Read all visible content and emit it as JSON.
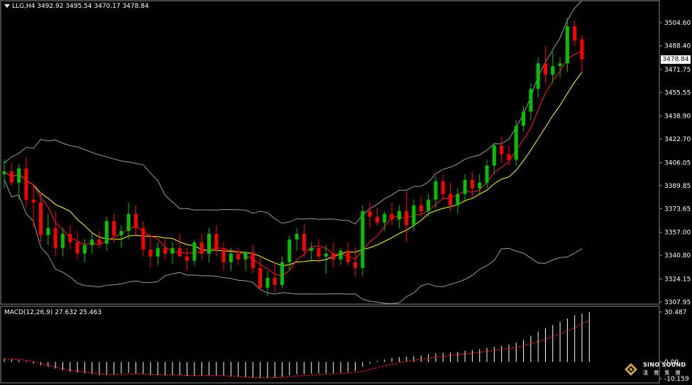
{
  "header": {
    "symbol_line": "LLG,H4  3492.92 3495.54 3470.17 3478.84"
  },
  "macd_header": "MACD(12,26,9) 27.632 25.463",
  "current_price_tag": "3478.84",
  "price_axis": [
    "3504.60",
    "3488.40",
    "3471.75",
    "3455.55",
    "3438.90",
    "3422.70",
    "3406.05",
    "3389.85",
    "3373.65",
    "3357.00",
    "3340.80",
    "3324.15",
    "3307.95"
  ],
  "macd_axis": [
    "30.487",
    "0.00",
    "-10.159"
  ],
  "logo": {
    "name": "SINO SOUND",
    "sub": "漢 聲 集 團"
  },
  "colors": {
    "bull": "#00c000",
    "bear": "#ff0000",
    "ma_fast": "#ff2020",
    "ma_slow": "#ffff40",
    "band": "#9a9a9a",
    "macd_signal": "#ff2020",
    "hist": "#ffffff"
  },
  "chart_data": {
    "type": "candlestick",
    "timeframe": "H4",
    "ylim": [
      3307.95,
      3504.6
    ],
    "candles": [
      {
        "o": 3398,
        "h": 3408,
        "l": 3388,
        "c": 3400
      },
      {
        "o": 3400,
        "h": 3406,
        "l": 3390,
        "c": 3392
      },
      {
        "o": 3392,
        "h": 3405,
        "l": 3380,
        "c": 3402
      },
      {
        "o": 3402,
        "h": 3410,
        "l": 3375,
        "c": 3380
      },
      {
        "o": 3380,
        "h": 3390,
        "l": 3360,
        "c": 3378
      },
      {
        "o": 3378,
        "h": 3385,
        "l": 3350,
        "c": 3355
      },
      {
        "o": 3355,
        "h": 3370,
        "l": 3348,
        "c": 3360
      },
      {
        "o": 3360,
        "h": 3372,
        "l": 3340,
        "c": 3346
      },
      {
        "o": 3346,
        "h": 3360,
        "l": 3340,
        "c": 3356
      },
      {
        "o": 3356,
        "h": 3362,
        "l": 3345,
        "c": 3350
      },
      {
        "o": 3350,
        "h": 3358,
        "l": 3338,
        "c": 3342
      },
      {
        "o": 3342,
        "h": 3352,
        "l": 3336,
        "c": 3348
      },
      {
        "o": 3348,
        "h": 3356,
        "l": 3342,
        "c": 3352
      },
      {
        "o": 3352,
        "h": 3358,
        "l": 3346,
        "c": 3349
      },
      {
        "o": 3349,
        "h": 3368,
        "l": 3344,
        "c": 3365
      },
      {
        "o": 3365,
        "h": 3370,
        "l": 3350,
        "c": 3355
      },
      {
        "o": 3355,
        "h": 3362,
        "l": 3346,
        "c": 3358
      },
      {
        "o": 3358,
        "h": 3378,
        "l": 3352,
        "c": 3370
      },
      {
        "o": 3370,
        "h": 3376,
        "l": 3355,
        "c": 3360
      },
      {
        "o": 3360,
        "h": 3365,
        "l": 3340,
        "c": 3345
      },
      {
        "o": 3345,
        "h": 3355,
        "l": 3332,
        "c": 3340
      },
      {
        "o": 3340,
        "h": 3350,
        "l": 3334,
        "c": 3346
      },
      {
        "o": 3346,
        "h": 3352,
        "l": 3338,
        "c": 3342
      },
      {
        "o": 3342,
        "h": 3350,
        "l": 3335,
        "c": 3346
      },
      {
        "o": 3346,
        "h": 3356,
        "l": 3340,
        "c": 3340
      },
      {
        "o": 3340,
        "h": 3346,
        "l": 3330,
        "c": 3337
      },
      {
        "o": 3337,
        "h": 3352,
        "l": 3334,
        "c": 3350
      },
      {
        "o": 3350,
        "h": 3356,
        "l": 3338,
        "c": 3342
      },
      {
        "o": 3342,
        "h": 3360,
        "l": 3336,
        "c": 3356
      },
      {
        "o": 3356,
        "h": 3362,
        "l": 3340,
        "c": 3345
      },
      {
        "o": 3345,
        "h": 3350,
        "l": 3330,
        "c": 3336
      },
      {
        "o": 3336,
        "h": 3346,
        "l": 3330,
        "c": 3342
      },
      {
        "o": 3342,
        "h": 3346,
        "l": 3334,
        "c": 3338
      },
      {
        "o": 3338,
        "h": 3344,
        "l": 3330,
        "c": 3343
      },
      {
        "o": 3343,
        "h": 3348,
        "l": 3328,
        "c": 3332
      },
      {
        "o": 3332,
        "h": 3340,
        "l": 3316,
        "c": 3318
      },
      {
        "o": 3318,
        "h": 3330,
        "l": 3312,
        "c": 3325
      },
      {
        "o": 3325,
        "h": 3336,
        "l": 3315,
        "c": 3320
      },
      {
        "o": 3320,
        "h": 3340,
        "l": 3318,
        "c": 3336
      },
      {
        "o": 3336,
        "h": 3355,
        "l": 3330,
        "c": 3352
      },
      {
        "o": 3352,
        "h": 3360,
        "l": 3344,
        "c": 3356
      },
      {
        "o": 3356,
        "h": 3362,
        "l": 3340,
        "c": 3344
      },
      {
        "o": 3344,
        "h": 3350,
        "l": 3336,
        "c": 3346
      },
      {
        "o": 3346,
        "h": 3352,
        "l": 3336,
        "c": 3340
      },
      {
        "o": 3340,
        "h": 3348,
        "l": 3328,
        "c": 3342
      },
      {
        "o": 3342,
        "h": 3350,
        "l": 3332,
        "c": 3338
      },
      {
        "o": 3338,
        "h": 3346,
        "l": 3334,
        "c": 3344
      },
      {
        "o": 3344,
        "h": 3350,
        "l": 3334,
        "c": 3336
      },
      {
        "o": 3336,
        "h": 3346,
        "l": 3326,
        "c": 3332
      },
      {
        "o": 3332,
        "h": 3376,
        "l": 3326,
        "c": 3372
      },
      {
        "o": 3372,
        "h": 3378,
        "l": 3360,
        "c": 3368
      },
      {
        "o": 3368,
        "h": 3374,
        "l": 3362,
        "c": 3364
      },
      {
        "o": 3364,
        "h": 3372,
        "l": 3358,
        "c": 3370
      },
      {
        "o": 3370,
        "h": 3378,
        "l": 3362,
        "c": 3366
      },
      {
        "o": 3366,
        "h": 3376,
        "l": 3360,
        "c": 3372
      },
      {
        "o": 3372,
        "h": 3386,
        "l": 3350,
        "c": 3362
      },
      {
        "o": 3362,
        "h": 3380,
        "l": 3358,
        "c": 3376
      },
      {
        "o": 3376,
        "h": 3382,
        "l": 3368,
        "c": 3372
      },
      {
        "o": 3372,
        "h": 3384,
        "l": 3368,
        "c": 3380
      },
      {
        "o": 3380,
        "h": 3396,
        "l": 3374,
        "c": 3393
      },
      {
        "o": 3393,
        "h": 3398,
        "l": 3380,
        "c": 3384
      },
      {
        "o": 3384,
        "h": 3392,
        "l": 3372,
        "c": 3376
      },
      {
        "o": 3376,
        "h": 3388,
        "l": 3370,
        "c": 3384
      },
      {
        "o": 3384,
        "h": 3398,
        "l": 3378,
        "c": 3394
      },
      {
        "o": 3394,
        "h": 3400,
        "l": 3382,
        "c": 3388
      },
      {
        "o": 3388,
        "h": 3398,
        "l": 3384,
        "c": 3392
      },
      {
        "o": 3392,
        "h": 3408,
        "l": 3388,
        "c": 3404
      },
      {
        "o": 3404,
        "h": 3420,
        "l": 3398,
        "c": 3418
      },
      {
        "o": 3418,
        "h": 3424,
        "l": 3406,
        "c": 3412
      },
      {
        "o": 3412,
        "h": 3418,
        "l": 3404,
        "c": 3408
      },
      {
        "o": 3408,
        "h": 3436,
        "l": 3404,
        "c": 3432
      },
      {
        "o": 3432,
        "h": 3446,
        "l": 3428,
        "c": 3442
      },
      {
        "o": 3442,
        "h": 3462,
        "l": 3436,
        "c": 3458
      },
      {
        "o": 3458,
        "h": 3480,
        "l": 3452,
        "c": 3476
      },
      {
        "o": 3476,
        "h": 3488,
        "l": 3462,
        "c": 3468
      },
      {
        "o": 3468,
        "h": 3484,
        "l": 3462,
        "c": 3474
      },
      {
        "o": 3474,
        "h": 3480,
        "l": 3466,
        "c": 3476
      },
      {
        "o": 3476,
        "h": 3508,
        "l": 3470,
        "c": 3502
      },
      {
        "o": 3502,
        "h": 3506,
        "l": 3488,
        "c": 3492
      },
      {
        "o": 3492.92,
        "h": 3495.54,
        "l": 3470.17,
        "c": 3478.84
      }
    ],
    "macd": {
      "ylim": [
        -10.159,
        30.487
      ],
      "hist": [
        2,
        1.5,
        1,
        0.5,
        -1,
        -2,
        -3,
        -4,
        -5,
        -6,
        -6.5,
        -7,
        -7.5,
        -8,
        -8,
        -7.5,
        -7,
        -6.5,
        -7,
        -7.5,
        -8,
        -8,
        -8.2,
        -8,
        -8,
        -8.5,
        -8.5,
        -8.2,
        -8,
        -8.3,
        -8.6,
        -9,
        -9.2,
        -9.5,
        -9.8,
        -10,
        -9.8,
        -9.5,
        -9,
        -8.2,
        -7.5,
        -7.5,
        -7.2,
        -7,
        -7,
        -6.8,
        -6.5,
        -6.2,
        -5.5,
        -3,
        -1,
        0.5,
        1.5,
        2.5,
        3,
        3.2,
        3.5,
        4,
        4.8,
        5.2,
        5.5,
        5.8,
        6.2,
        6.8,
        7.2,
        7.8,
        8.5,
        9.2,
        9.8,
        10.5,
        11.8,
        13.5,
        16,
        18.5,
        20.5,
        22.5,
        24.5,
        26.5,
        28.5,
        29.5,
        30.4
      ],
      "signal": [
        2,
        1.8,
        1.5,
        1,
        0.2,
        -0.8,
        -2,
        -3,
        -4,
        -5,
        -5.6,
        -6.2,
        -6.7,
        -7.2,
        -7.6,
        -7.7,
        -7.6,
        -7.3,
        -7.3,
        -7.4,
        -7.6,
        -7.8,
        -8,
        -8,
        -8,
        -8.2,
        -8.3,
        -8.3,
        -8.2,
        -8.3,
        -8.4,
        -8.6,
        -8.9,
        -9.1,
        -9.4,
        -9.6,
        -9.7,
        -9.6,
        -9.4,
        -9,
        -8.6,
        -8.3,
        -8,
        -7.8,
        -7.5,
        -7.3,
        -7,
        -6.7,
        -6.3,
        -5.6,
        -4.6,
        -3.5,
        -2.4,
        -1.4,
        -0.5,
        0.3,
        1,
        1.6,
        2.3,
        2.9,
        3.4,
        3.9,
        4.4,
        4.9,
        5.4,
        5.9,
        6.5,
        7,
        7.6,
        8.2,
        8.9,
        9.8,
        11,
        12.4,
        13.9,
        15.5,
        17.2,
        19,
        20.8,
        23,
        25.5
      ]
    }
  }
}
